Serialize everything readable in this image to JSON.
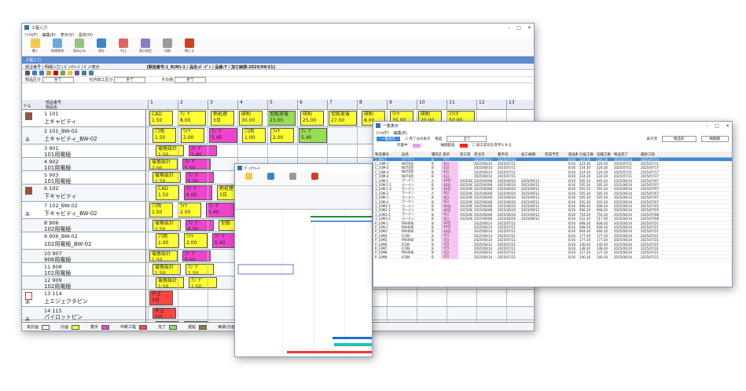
{
  "main": {
    "title": "工程入力",
    "menu": [
      "ﾌｧｲﾙ(F)",
      "編集(E)",
      "表示(V)",
      "設定(O)"
    ],
    "ribbon": [
      "開く",
      "新規登録",
      "読み込み",
      "保存",
      "中止",
      "表示設定",
      "印刷",
      "閉じる"
    ],
    "tab_label": "工程入力",
    "order_strip": "受注番号 | 明細入力 | ｶﾞﾝﾄﾁｬｰﾄ | ｶﾞﾝﾄ表示",
    "project_info": "[製造番号:1_R(M)-1 / 品名:ｶﾞｰﾃﾞﾝ / 品番:T / 加工納期:2025/09/21]",
    "filter1_label": "部品区分",
    "filter1_value": "全て",
    "filter2_label": "社内加工区分",
    "filter2_value": "全て",
    "filter3_label": "その他",
    "filter3_value": "全て",
    "col_label": "ﾂｰﾙ",
    "col_part": "部品番号",
    "col_partname": "部品名",
    "days": [
      "1",
      "2",
      "3",
      "4",
      "5",
      "6",
      "7",
      "8",
      "9",
      "10",
      "11",
      "12",
      "13",
      "14"
    ],
    "rows": [
      {
        "no": "1 101",
        "name": "上キャビティ",
        "mark": "",
        "tasks": [
          {
            "l": "CAD",
            "v": "1.50",
            "c": "y"
          },
          {
            "l": "ｱｼﾞｸﾞ",
            "v": "8.00",
            "c": "y"
          },
          {
            "l": "熱処理",
            "v": "3日",
            "c": "y"
          },
          {
            "l": "研削",
            "v": "30.00",
            "c": "y"
          },
          {
            "l": "型彫放電",
            "v": "23.00",
            "c": "gr"
          },
          {
            "l": "研削",
            "v": "25.00",
            "c": "y"
          },
          {
            "l": "型彫放電",
            "v": "27.00",
            "c": "y"
          },
          {
            "l": "研削",
            "v": "8.00",
            "c": "y"
          },
          {
            "l": "ﾜｲﾔ",
            "v": "35.00",
            "c": "y"
          },
          {
            "l": "研削",
            "v": "20.00",
            "c": "y"
          },
          {
            "l": "ｽﾗｲﾀﾞ",
            "v": "50.00",
            "c": "y"
          }
        ]
      },
      {
        "no": "2 101_BW-02",
        "name": "上キャビティ_BW-02",
        "mark": "未",
        "tasks": [
          {
            "l": "穴明",
            "v": "1.50",
            "c": "y"
          },
          {
            "l": "ﾜｲﾔ",
            "v": "2.00",
            "c": "y"
          },
          {
            "l": "ｱｼﾞｸﾞ",
            "v": "5.40",
            "c": "mg"
          },
          {
            "l": "穴明",
            "v": "1.00",
            "c": "y"
          },
          {
            "l": "ﾜｲﾔ",
            "v": "2.00",
            "c": "y"
          },
          {
            "l": "ｱｼﾞｸﾞ",
            "v": "5.40",
            "c": "gr"
          }
        ]
      },
      {
        "no": "3 901",
        "name": "101用電極",
        "mark": "",
        "tasks": [
          {
            "l": "電極設計",
            "v": "1.50",
            "c": "y"
          },
          {
            "l": "ｱｼﾞｸﾞ",
            "v": "5.40",
            "c": "mg"
          }
        ]
      },
      {
        "no": "4 902",
        "name": "101用電極",
        "mark": "",
        "tasks": [
          {
            "l": "電極設計",
            "v": "2.00",
            "c": "y"
          },
          {
            "l": "ｱｼﾞｸﾞ",
            "v": "5.50",
            "c": "mg"
          }
        ]
      },
      {
        "no": "5 903",
        "name": "101用電極",
        "mark": "",
        "tasks": [
          {
            "l": "電極設計",
            "v": "1.50",
            "c": "y"
          },
          {
            "l": "ｱｼﾞｸﾞ",
            "v": "5.50",
            "c": "mg"
          }
        ]
      },
      {
        "no": "6 102",
        "name": "下キャビティ",
        "mark": "",
        "tasks": [
          {
            "l": "CAD",
            "v": "1.50",
            "c": "y"
          },
          {
            "l": "ｱｼﾞｸﾞ",
            "v": "6.00",
            "c": "mg"
          },
          {
            "l": "熱処理",
            "v": "3日",
            "c": "y"
          },
          {
            "l": "研削",
            "v": "18.00",
            "c": "gr"
          }
        ]
      },
      {
        "no": "7 102_BW-02",
        "name": "下キャビティ_BW-02",
        "mark": "未",
        "tasks": [
          {
            "l": "穴明",
            "v": "1.50",
            "c": "y"
          },
          {
            "l": "ﾜｲﾔ",
            "v": "2.00",
            "c": "y"
          },
          {
            "l": "ｱｼﾞｸﾞ",
            "v": "5.40",
            "c": "mg"
          },
          {
            "l": "ﾜｲﾔ",
            "v": "",
            "c": "y"
          }
        ]
      },
      {
        "no": "8 906",
        "name": "102用電極",
        "mark": "",
        "tasks": [
          {
            "l": "電極設計",
            "v": "2.50",
            "c": "y"
          },
          {
            "l": "ｱｼﾞｸﾞ",
            "v": "6.50",
            "c": "mg"
          },
          {
            "l": "型彫",
            "v": "",
            "c": "y"
          }
        ]
      },
      {
        "no": "9 906_BW-02",
        "name": "102用電極_BW-02",
        "mark": "",
        "tasks": [
          {
            "l": "穴明",
            "v": "1.00",
            "c": "y"
          },
          {
            "l": "ﾜｲﾔ",
            "v": "2.00",
            "c": "y"
          },
          {
            "l": "ｱｼﾞｸﾞ",
            "v": "5.40",
            "c": "mg"
          }
        ]
      },
      {
        "no": "10 907",
        "name": "906用電極",
        "mark": "",
        "tasks": [
          {
            "l": "電極設計",
            "v": "1.50",
            "c": "y"
          },
          {
            "l": "ｱｼﾞｸﾞ",
            "v": "5.50",
            "c": "mg"
          }
        ]
      },
      {
        "no": "11 908",
        "name": "102用電極",
        "mark": "",
        "tasks": [
          {
            "l": "電極設計",
            "v": "1.50",
            "c": "y"
          },
          {
            "l": "ｱｼﾞｸﾞ",
            "v": "1.50",
            "c": "y"
          }
        ]
      },
      {
        "no": "12 909",
        "name": "102用電極",
        "mark": "",
        "tasks": [
          {
            "l": "電極設計",
            "v": "1.50",
            "c": "y"
          },
          {
            "l": "ｱｼﾞｸﾞ",
            "v": "1.50",
            "c": "y"
          }
        ]
      },
      {
        "no": "13 114",
        "name": "上エジェクタピン",
        "mark": "未",
        "tasks": [
          {
            "l": "外注",
            "v": "3日",
            "c": "rd"
          }
        ]
      },
      {
        "no": "14 115",
        "name": "パイロットピン",
        "mark": "未",
        "tasks": [
          {
            "l": "外注",
            "v": "3日",
            "c": "rd"
          }
        ]
      },
      {
        "no": "15 117",
        "name": "スプルーブシュ",
        "mark": "未",
        "tasks": [
          {
            "l": "購入",
            "v": "2日",
            "c": "gr"
          },
          {
            "l": "型彫",
            "v": "",
            "c": "gr"
          }
        ]
      }
    ],
    "legend": [
      {
        "l": "未計画",
        "c": "#ffffff"
      },
      {
        "l": "計画",
        "c": "#ffff33"
      },
      {
        "l": "着手",
        "c": "#ee44cc"
      },
      {
        "l": "中断工程",
        "c": "#ff4444"
      },
      {
        "l": "完了",
        "c": "#99dd55"
      },
      {
        "l": "遅延",
        "c": "#9a7a3a"
      },
      {
        "l": "実績(計画)",
        "c": "#777777"
      },
      {
        "l": "実績(遅)",
        "c": "#1d6fd8"
      }
    ]
  },
  "mid": {
    "title": "ｶﾞﾝﾄﾁｬｰﾄ"
  },
  "list": {
    "title": "一覧表示",
    "menu": [
      "ﾌｧｲﾙ(F)",
      "編集(E)"
    ],
    "filter_label": "完了分の表示",
    "filter_field_label": "製品",
    "filter_value": "全て",
    "display_label": "表示済",
    "display_value": "製品別",
    "sort_value": "納期順",
    "legend1": "作業中",
    "legend2": "納期超過",
    "legend3": "加工前日を赤字にする",
    "headers": [
      "製造番号",
      "品名",
      "優先度",
      "進捗",
      "残工程",
      "受注日",
      "着手日",
      "加工納期",
      "完成予定",
      "部品数",
      "計画工数",
      "実績工数",
      "製品完了",
      "最終工程"
    ],
    "rows": [
      [
        "1_RM-1",
        "ガーデン",
        "B",
        "-1日",
        "",
        "2025/06/14",
        "2025/07/14",
        "",
        "",
        "6/16",
        "224.30",
        "224.30",
        "2025/07/14",
        "2025/07/14"
      ],
      [
        "C_10M-1",
        "NOTE型",
        "B",
        "-1日",
        "",
        "2025/06/14",
        "2025/07/11",
        "",
        "",
        "6/16",
        "224.30",
        "224.30",
        "2025/07/11",
        "2025/07/11"
      ],
      [
        "C_10M-2",
        "NOTE型",
        "B",
        "-1日",
        "",
        "2025/06/14",
        "2025/07/11",
        "",
        "",
        "6/16",
        "224.30",
        "224.30",
        "2025/07/11",
        "2025/07/17"
      ],
      [
        "C_10M-3",
        "NOTE型",
        "B",
        "-1日",
        "",
        "2025/06/14",
        "2025/07/11",
        "",
        "",
        "6/16",
        "224.30",
        "224.30",
        "2025/07/11",
        "2025/07/17"
      ],
      [
        "C_10M-4",
        "NOTE型",
        "B",
        "-1日",
        "",
        "2025/06/14",
        "2025/07/11",
        "",
        "",
        "6/16",
        "224.30",
        "224.30",
        "2025/07/11",
        "2025/07/17"
      ],
      [
        "1_10M-1",
        "ガーデン",
        "A",
        "-10日",
        "2025/06/02",
        "2025/06/08",
        "2025/06/20",
        "2025/09/12",
        "",
        "6/16",
        "505.30",
        "405.30",
        "2025/06/14",
        "2025/07/07"
      ],
      [
        "1_10M-1-1",
        "ガーデン",
        "B",
        "-10日",
        "2025/06/02",
        "2025/06/08",
        "2025/06/20",
        "2025/09/12",
        "",
        "6/16",
        "505.30",
        "505.30",
        "2025/06/14",
        "2025/07/07"
      ],
      [
        "1_10M-1-2",
        "ガーデン",
        "B",
        "-10日",
        "2025/06/02",
        "2025/06/08",
        "2025/06/20",
        "2025/09/12",
        "",
        "6/16",
        "505.30",
        "505.30",
        "2025/06/14",
        "2025/07/07"
      ],
      [
        "1_10M-2",
        "ガーデン",
        "A",
        "-5日",
        "2025/06/02",
        "2025/06/08",
        "2025/06/20",
        "2025/09/12",
        "",
        "6/16",
        "505.30",
        "505.30",
        "2025/06/14",
        "2025/07/07"
      ],
      [
        "1_10M-3",
        "ガーデン",
        "B",
        "-5日",
        "2025/06/02",
        "2025/06/08",
        "2025/06/20",
        "2025/09/12",
        "",
        "6/16",
        "505.30",
        "505.30",
        "2025/06/14",
        "2025/07/07"
      ],
      [
        "1_10M-4",
        "ガーデン",
        "B",
        "-5日",
        "2025/06/02",
        "2025/06/08",
        "2025/06/20",
        "2025/09/12",
        "",
        "6/16",
        "505.30",
        "505.30",
        "2025/06/14",
        "2025/07/07"
      ],
      [
        "1_10M2-1",
        "ガーデン",
        "B",
        "-10日",
        "2025/06/02",
        "2025/06/08",
        "2025/06/20",
        "2025/09/12",
        "",
        "6/16",
        "608.30",
        "608.30",
        "2025/06/14",
        "2025/07/05"
      ],
      [
        "1_10M2-2",
        "ガーデン",
        "B",
        "-10日",
        "2025/06/02",
        "2025/06/08",
        "2025/06/20",
        "2025/09/12",
        "",
        "6/16",
        "608.30",
        "608.30",
        "2025/06/14",
        "2025/07/05"
      ],
      [
        "1_10M3-1",
        "ガーデン",
        "B",
        "-5日",
        "2025/06/02",
        "2025/06/08",
        "2025/06/20",
        "2025/09/12",
        "",
        "6/16",
        "754.30",
        "754.30",
        "2025/06/14",
        "2025/07/08"
      ],
      [
        "1_10M3-2",
        "ガーデン",
        "B",
        "-5日",
        "2025/06/02",
        "2025/06/08",
        "2025/06/20",
        "2025/09/12",
        "",
        "6/16",
        "522.30",
        "517.30",
        "2025/06/14",
        "2025/07/08"
      ],
      [
        "P_10M-1",
        "PRAIRIE",
        "B",
        "-10日",
        "",
        "2025/06/14",
        "2025/07/21",
        "",
        "",
        "6/16",
        "608.30",
        "608.30",
        "2025/06/14",
        "2025/07/21"
      ],
      [
        "P_10M-2",
        "PRAIRIE",
        "B",
        "-10日",
        "",
        "2025/06/14",
        "2025/07/21",
        "",
        "",
        "6/16",
        "608.30",
        "608.30",
        "2025/06/14",
        "2025/07/21"
      ],
      [
        "P_10M3",
        "PRAIRIE",
        "B",
        "-10日",
        "",
        "2025/06/14",
        "2025/07/21",
        "",
        "",
        "6/16",
        "604.30",
        "604.30",
        "2025/06/14",
        "2025/07/21"
      ],
      [
        "P_10M4",
        "ICON",
        "B",
        "-7日",
        "",
        "2025/06/14",
        "2025/07/21",
        "",
        "",
        "6/16",
        "177.30",
        "177.30",
        "2025/06/14",
        "2025/07/21"
      ],
      [
        "P_10M5",
        "PRAIRIE",
        "B",
        "-7日",
        "",
        "2025/06/14",
        "2025/07/21",
        "",
        "",
        "6/16",
        "177.30",
        "177.30",
        "2025/06/14",
        "2025/07/21"
      ],
      [
        "P_10M6",
        "ICON",
        "B",
        "-7日",
        "",
        "2025/06/14",
        "2025/07/21",
        "",
        "",
        "6/16",
        "140.30",
        "140.30",
        "2025/06/14",
        "2025/07/21"
      ],
      [
        "P_10M7",
        "ICON",
        "B",
        "-7日",
        "",
        "2025/06/14",
        "2025/07/21",
        "",
        "",
        "6/16",
        "148.30",
        "148.30",
        "2025/06/14",
        "2025/07/21"
      ],
      [
        "P_10M8",
        "PRAIRIE",
        "B",
        "-7日",
        "",
        "2025/06/14",
        "2025/07/21",
        "",
        "",
        "6/16",
        "137.30",
        "137.30",
        "2025/06/14",
        "2025/07/21"
      ],
      [
        "P_10M9",
        "ICON",
        "B",
        "-7日",
        "",
        "2025/06/14",
        "2025/07/21",
        "",
        "",
        "6/16",
        "140.30",
        "140.30",
        "2025/06/14",
        "2025/07/21"
      ]
    ]
  }
}
